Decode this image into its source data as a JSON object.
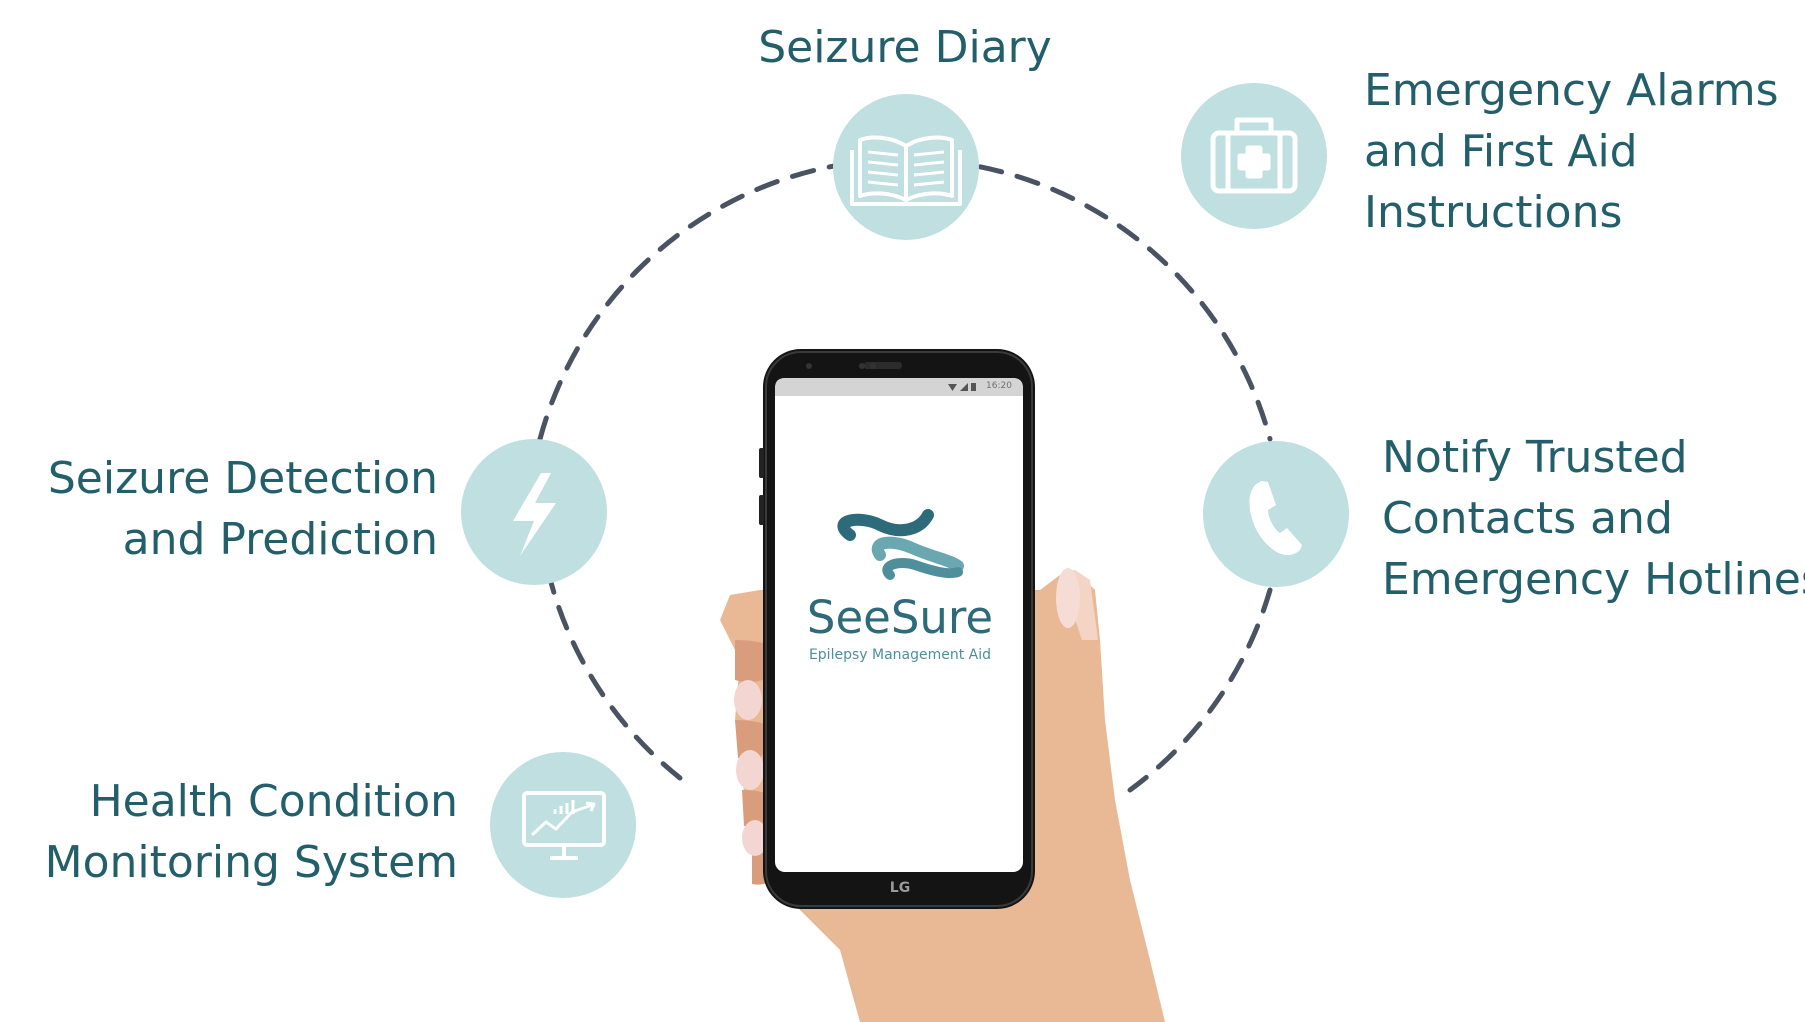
{
  "features": {
    "seizure_diary": {
      "lines": [
        "Seizure Diary"
      ],
      "icon": "open-book-icon"
    },
    "emergency_alarms": {
      "lines": [
        "Emergency Alarms",
        "and First Aid",
        "Instructions"
      ],
      "icon": "first-aid-kit-icon"
    },
    "seizure_detection": {
      "lines": [
        "Seizure Detection",
        "and Prediction"
      ],
      "icon": "lightning-bolt-icon"
    },
    "notify_contacts": {
      "lines": [
        "Notify Trusted",
        "Contacts and",
        "Emergency Hotlines"
      ],
      "icon": "phone-handset-icon"
    },
    "health_monitoring": {
      "lines": [
        "Health Condition",
        "Monitoring System"
      ],
      "icon": "monitor-chart-icon"
    }
  },
  "phone": {
    "app_name": "SeeSure",
    "tagline": "Epilepsy Management Aid",
    "status_time": "16:20",
    "brand": "LG"
  },
  "colors": {
    "label_text": "#235f6a",
    "icon_circle": "#bfdfe0",
    "dashed_ring": "#4a5362",
    "brand_teal": "#2d6b7b",
    "brand_light_teal": "#6aa7b0"
  }
}
